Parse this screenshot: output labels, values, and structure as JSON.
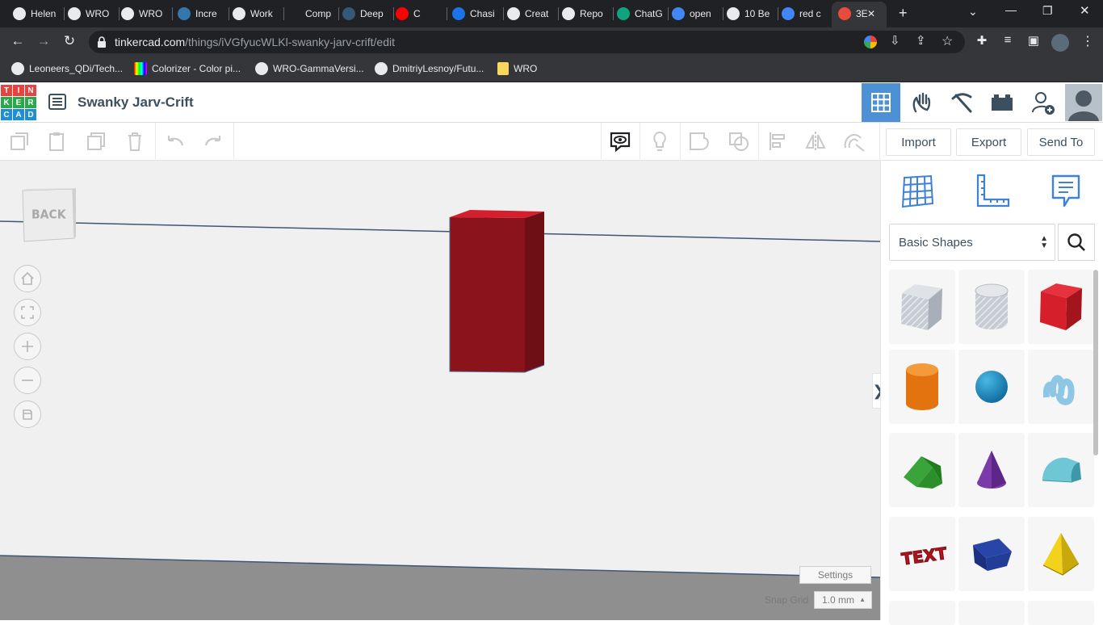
{
  "browser": {
    "tabs": [
      {
        "label": "Helen",
        "favicon": "github-icon"
      },
      {
        "label": "WRO",
        "favicon": "github-icon"
      },
      {
        "label": "WRO",
        "favicon": "wordpress-icon"
      },
      {
        "label": "Incre",
        "favicon": "pypi-icon"
      },
      {
        "label": "Work",
        "favicon": "github-icon"
      },
      {
        "label": "Comp",
        "favicon": "blank-icon"
      },
      {
        "label": "Deep",
        "favicon": "tds-icon"
      },
      {
        "label": "C",
        "favicon": "youtube-icon"
      },
      {
        "label": "Chasi",
        "favicon": "chasi-icon"
      },
      {
        "label": "Creat",
        "favicon": "creative-commons-icon"
      },
      {
        "label": "Repo",
        "favicon": "github-icon"
      },
      {
        "label": "ChatG",
        "favicon": "openai-icon"
      },
      {
        "label": "open",
        "favicon": "google-icon"
      },
      {
        "label": "10 Be",
        "favicon": "medium-icon"
      },
      {
        "label": "red c",
        "favicon": "google-icon"
      },
      {
        "label": "3E",
        "favicon": "tinkercad-icon"
      }
    ],
    "new_tab": "+",
    "url_host": "tinkercad.com",
    "url_path": "/things/iVGfyucWLKl-swanky-jarv-crift/edit",
    "bookmarks": [
      {
        "label": "Leoneers_QDi/Tech..."
      },
      {
        "label": "Colorizer - Color pi..."
      },
      {
        "label": "WRO-GammaVersi..."
      },
      {
        "label": "DmitriyLesnoy/Futu..."
      },
      {
        "label": "WRO"
      }
    ]
  },
  "header": {
    "logo_letters": [
      "T",
      "I",
      "N",
      "K",
      "E",
      "R",
      "C",
      "A",
      "D"
    ],
    "title": "Swanky Jarv-Crift"
  },
  "toolbar": {
    "import_label": "Import",
    "export_label": "Export",
    "sendto_label": "Send To"
  },
  "viewcube": {
    "face_label": "BACK"
  },
  "workplane": {
    "settings_label": "Settings",
    "snap_label": "Snap Grid",
    "snap_value": "1.0 mm",
    "collapse_glyph": "❯"
  },
  "panel": {
    "category": "Basic Shapes",
    "shapes": [
      {
        "name": "box-hole"
      },
      {
        "name": "cylinder-hole"
      },
      {
        "name": "box"
      },
      {
        "name": "cylinder"
      },
      {
        "name": "sphere"
      },
      {
        "name": "scribble"
      },
      {
        "name": "roof"
      },
      {
        "name": "cone"
      },
      {
        "name": "round-roof"
      },
      {
        "name": "text"
      },
      {
        "name": "wedge"
      },
      {
        "name": "pyramid"
      }
    ]
  },
  "colors": {
    "accent": "#4d90d6",
    "shape_red": "#8b131c",
    "chrome_dark": "#202124"
  }
}
